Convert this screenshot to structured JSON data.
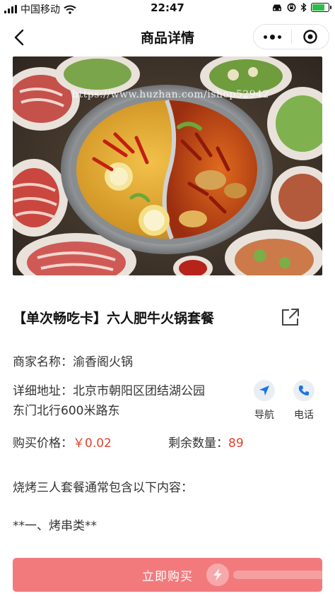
{
  "status_bar": {
    "carrier": "中国移动",
    "time": "22:47"
  },
  "nav": {
    "title": "商品详情"
  },
  "hero": {
    "watermark": "https://www.huzhan.com/ishop52942"
  },
  "product": {
    "title": "【单次畅吃卡】六人肥牛火锅套餐"
  },
  "info": {
    "shop_label": "商家名称：",
    "shop_value": "渝香阁火锅",
    "address_label": "详细地址：",
    "address_line1": "北京市朝阳区团结湖公园",
    "address_line2": "东门北行600米路东",
    "price_label": "购买价格：",
    "price_value": "￥0.02",
    "stock_label": "剩余数量：",
    "stock_value": "89"
  },
  "actions": {
    "navigate_label": "导航",
    "call_label": "电话"
  },
  "description": {
    "line1": "烧烤三人套餐通常包含以下内容：",
    "line2": "**一、烤串类**"
  },
  "buy": {
    "label": "立即购买"
  },
  "colors": {
    "accent_red": "#e0422e",
    "buy_button": "#f27a7d",
    "icon_blue": "#1a73e8",
    "battery_green": "#2dbd4a"
  }
}
